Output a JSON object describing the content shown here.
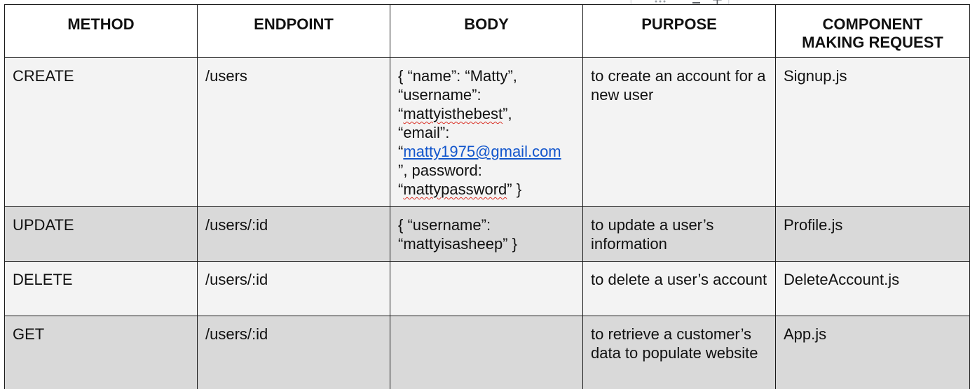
{
  "table": {
    "headers": [
      "METHOD",
      "ENDPOINT",
      "BODY",
      "PURPOSE",
      "COMPONENT MAKING REQUEST"
    ],
    "header_component_line1": "COMPONENT",
    "header_component_line2": "MAKING REQUEST",
    "rows": [
      {
        "method": "CREATE",
        "endpoint": "/users",
        "body_lines": {
          "l1": "{ “name”: “Matty”,",
          "l2": "“username”:",
          "l3_open": "“",
          "l3_word": "mattyisthebest",
          "l3_close": "”,",
          "l4": "“email”:",
          "l5_open": "“",
          "l5_link": "matty1975@gmail.com",
          "l6": "”, password:",
          "l7_open": "“",
          "l7_word": "mattypassword",
          "l7_close": "” }"
        },
        "purpose": "to create an account for a new user",
        "component": "Signup.js"
      },
      {
        "method": "UPDATE",
        "endpoint": "/users/:id",
        "body_lines": {
          "l1": "{ “username”:",
          "l2": "“mattyisasheep” }"
        },
        "purpose": "to update a user’s information",
        "component": "Profile.js"
      },
      {
        "method": "DELETE",
        "endpoint": "/users/:id",
        "body": "",
        "purpose": "to delete a user’s account",
        "component": "DeleteAccount.js"
      },
      {
        "method": "GET",
        "endpoint": "/users/:id",
        "body": "",
        "purpose": "to retrieve a customer’s data to populate website",
        "component": "App.js"
      }
    ]
  },
  "toolbar": {
    "icons": [
      "drag-handle-icon",
      "sort-icon",
      "plus-icon"
    ],
    "plus_glyph": "+"
  }
}
